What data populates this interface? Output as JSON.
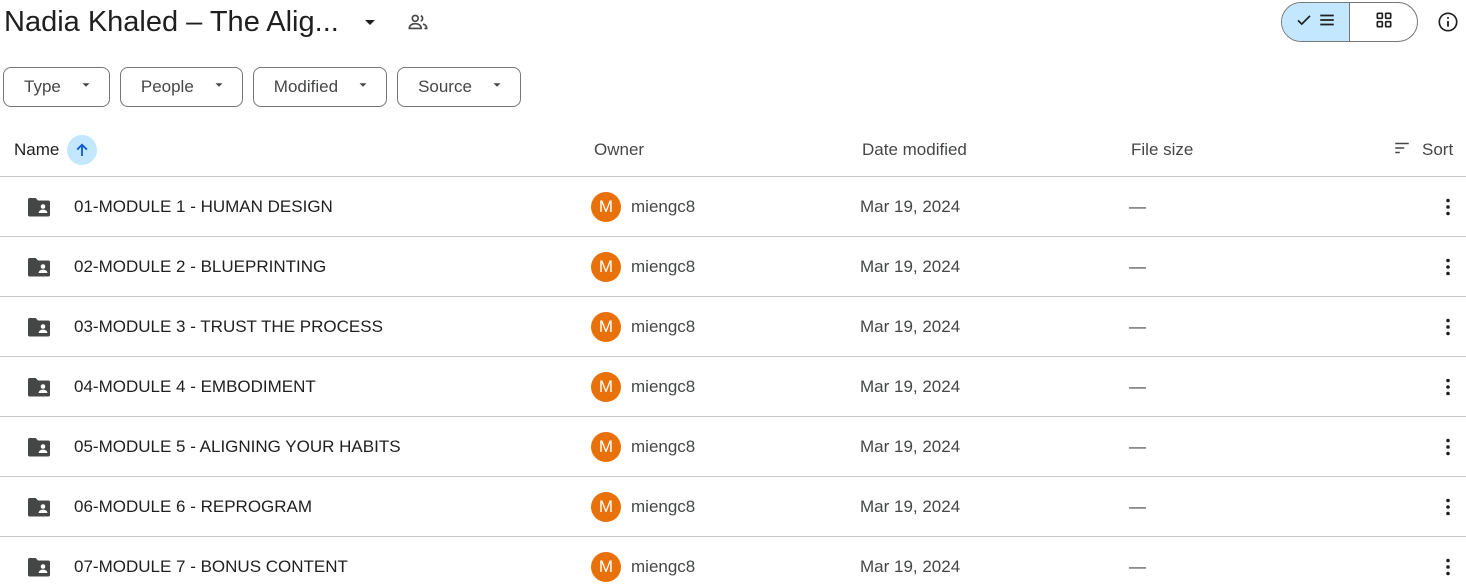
{
  "header": {
    "title": "Nadia Khaled – The Alig...",
    "caret_icon": "arrow-drop-down-icon",
    "shared_icon": "people-icon",
    "view_toggle": {
      "list_icon": "check-list-icon",
      "grid_icon": "grid-icon",
      "active": "list"
    },
    "info_icon": "info-icon"
  },
  "filters": [
    {
      "label": "Type"
    },
    {
      "label": "People"
    },
    {
      "label": "Modified"
    },
    {
      "label": "Source"
    }
  ],
  "columns": {
    "name": "Name",
    "owner": "Owner",
    "date_modified": "Date modified",
    "file_size": "File size",
    "sort": "Sort"
  },
  "files": [
    {
      "name": "01-MODULE 1 - HUMAN DESIGN",
      "owner_initial": "M",
      "owner": "miengc8",
      "date": "Mar 19, 2024",
      "size": "—"
    },
    {
      "name": "02-MODULE 2 - BLUEPRINTING",
      "owner_initial": "M",
      "owner": "miengc8",
      "date": "Mar 19, 2024",
      "size": "—"
    },
    {
      "name": "03-MODULE 3 - TRUST THE PROCESS",
      "owner_initial": "M",
      "owner": "miengc8",
      "date": "Mar 19, 2024",
      "size": "—"
    },
    {
      "name": "04-MODULE 4 - EMBODIMENT",
      "owner_initial": "M",
      "owner": "miengc8",
      "date": "Mar 19, 2024",
      "size": "—"
    },
    {
      "name": "05-MODULE 5 - ALIGNING YOUR HABITS",
      "owner_initial": "M",
      "owner": "miengc8",
      "date": "Mar 19, 2024",
      "size": "—"
    },
    {
      "name": "06-MODULE 6 - REPROGRAM",
      "owner_initial": "M",
      "owner": "miengc8",
      "date": "Mar 19, 2024",
      "size": "—"
    },
    {
      "name": "07-MODULE 7 - BONUS CONTENT",
      "owner_initial": "M",
      "owner": "miengc8",
      "date": "Mar 19, 2024",
      "size": "—"
    }
  ],
  "colors": {
    "accent": "#c2e7ff",
    "avatar": "#e8710a",
    "text": "#1f1f1f",
    "muted": "#444746",
    "border": "#c4c7c5"
  }
}
